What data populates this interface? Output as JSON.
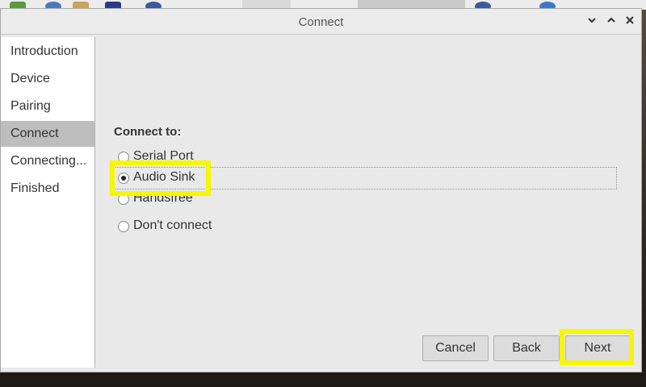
{
  "window": {
    "title": "Connect"
  },
  "titlebar": {
    "minimize_icon": "chevron-down-icon",
    "maximize_icon": "chevron-up-icon",
    "close_icon": "close-icon"
  },
  "sidebar": {
    "items": [
      {
        "label": "Introduction",
        "active": false
      },
      {
        "label": "Device",
        "active": false
      },
      {
        "label": "Pairing",
        "active": false
      },
      {
        "label": "Connect",
        "active": true
      },
      {
        "label": "Connecting...",
        "active": false
      },
      {
        "label": "Finished",
        "active": false
      }
    ]
  },
  "main": {
    "connect_label": "Connect to:",
    "options": [
      {
        "label": "Serial Port",
        "checked": false
      },
      {
        "label": "Audio Sink",
        "checked": true
      },
      {
        "label": "Handsfree",
        "checked": false
      },
      {
        "label": "Don't connect",
        "checked": false
      }
    ]
  },
  "buttons": {
    "cancel": "Cancel",
    "back": "Back",
    "next": "Next"
  },
  "colors": {
    "highlight": "#f6f600",
    "selected_sidebar": "#bdbdbd",
    "window_bg": "#e9e9e9"
  }
}
